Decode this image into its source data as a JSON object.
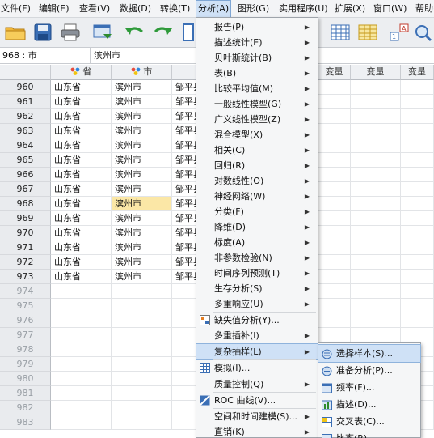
{
  "menubar": {
    "items": [
      {
        "label": "文件(F)"
      },
      {
        "label": "编辑(E)"
      },
      {
        "label": "查看(V)"
      },
      {
        "label": "数据(D)"
      },
      {
        "label": "转换(T)"
      },
      {
        "label": "分析(A)"
      },
      {
        "label": "图形(G)"
      },
      {
        "label": "实用程序(U)"
      },
      {
        "label": "扩展(X)"
      },
      {
        "label": "窗口(W)"
      },
      {
        "label": "帮助("
      }
    ],
    "active_index": 5
  },
  "cell_bar": {
    "ref": "968 : 市",
    "value": "滨州市"
  },
  "grid": {
    "columns": [
      "省",
      "市",
      "",
      "变量",
      "变量",
      "变量"
    ],
    "rows": [
      {
        "num": "960",
        "a": "山东省",
        "b": "滨州市",
        "c": "邹平县"
      },
      {
        "num": "961",
        "a": "山东省",
        "b": "滨州市",
        "c": "邹平县"
      },
      {
        "num": "962",
        "a": "山东省",
        "b": "滨州市",
        "c": "邹平县"
      },
      {
        "num": "963",
        "a": "山东省",
        "b": "滨州市",
        "c": "邹平县"
      },
      {
        "num": "964",
        "a": "山东省",
        "b": "滨州市",
        "c": "邹平县"
      },
      {
        "num": "965",
        "a": "山东省",
        "b": "滨州市",
        "c": "邹平县"
      },
      {
        "num": "966",
        "a": "山东省",
        "b": "滨州市",
        "c": "邹平县"
      },
      {
        "num": "967",
        "a": "山东省",
        "b": "滨州市",
        "c": "邹平县"
      },
      {
        "num": "968",
        "a": "山东省",
        "b": "滨州市",
        "c": "邹平县"
      },
      {
        "num": "969",
        "a": "山东省",
        "b": "滨州市",
        "c": "邹平县"
      },
      {
        "num": "970",
        "a": "山东省",
        "b": "滨州市",
        "c": "邹平县"
      },
      {
        "num": "971",
        "a": "山东省",
        "b": "滨州市",
        "c": "邹平县"
      },
      {
        "num": "972",
        "a": "山东省",
        "b": "滨州市",
        "c": "邹平县"
      },
      {
        "num": "973",
        "a": "山东省",
        "b": "滨州市",
        "c": "邹平县"
      },
      {
        "num": "974",
        "a": "",
        "b": "",
        "c": ""
      },
      {
        "num": "975",
        "a": "",
        "b": "",
        "c": ""
      },
      {
        "num": "976",
        "a": "",
        "b": "",
        "c": ""
      },
      {
        "num": "977",
        "a": "",
        "b": "",
        "c": ""
      },
      {
        "num": "978",
        "a": "",
        "b": "",
        "c": ""
      },
      {
        "num": "979",
        "a": "",
        "b": "",
        "c": ""
      },
      {
        "num": "980",
        "a": "",
        "b": "",
        "c": ""
      },
      {
        "num": "981",
        "a": "",
        "b": "",
        "c": ""
      },
      {
        "num": "982",
        "a": "",
        "b": "",
        "c": ""
      },
      {
        "num": "983",
        "a": "",
        "b": "",
        "c": ""
      }
    ],
    "selected_row": 8
  },
  "analysis_menu": {
    "items": [
      {
        "label": "报告(P)",
        "submenu": true
      },
      {
        "label": "描述统计(E)",
        "submenu": true
      },
      {
        "label": "贝叶斯统计(B)",
        "submenu": true
      },
      {
        "label": "表(B)",
        "submenu": true
      },
      {
        "label": "比较平均值(M)",
        "submenu": true
      },
      {
        "label": "一般线性模型(G)",
        "submenu": true
      },
      {
        "label": "广义线性模型(Z)",
        "submenu": true
      },
      {
        "label": "混合模型(X)",
        "submenu": true
      },
      {
        "label": "相关(C)",
        "submenu": true
      },
      {
        "label": "回归(R)",
        "submenu": true
      },
      {
        "label": "对数线性(O)",
        "submenu": true
      },
      {
        "label": "神经网络(W)",
        "submenu": true
      },
      {
        "label": "分类(F)",
        "submenu": true
      },
      {
        "label": "降维(D)",
        "submenu": true
      },
      {
        "label": "标度(A)",
        "submenu": true
      },
      {
        "label": "非参数检验(N)",
        "submenu": true
      },
      {
        "label": "时间序列预测(T)",
        "submenu": true
      },
      {
        "label": "生存分析(S)",
        "submenu": true
      },
      {
        "label": "多重响应(U)",
        "submenu": true
      },
      {
        "label": "缺失值分析(Y)...",
        "submenu": false,
        "icon": "missing-value-icon"
      },
      {
        "label": "多重插补(I)",
        "submenu": true
      },
      {
        "label": "复杂抽样(L)",
        "submenu": true
      },
      {
        "label": "模拟(I)...",
        "submenu": false,
        "icon": "simulation-icon"
      },
      {
        "label": "质量控制(Q)",
        "submenu": true
      },
      {
        "label": "ROC 曲线(V)...",
        "submenu": false,
        "icon": "roc-curve-icon"
      },
      {
        "label": "空间和时间建模(S)...",
        "submenu": true
      },
      {
        "label": "直销(K)",
        "submenu": true
      }
    ],
    "highlighted_index": 21
  },
  "submenu": {
    "items": [
      {
        "label": "选择样本(S)...",
        "icon": "select-sample-icon"
      },
      {
        "label": "准备分析(P)...",
        "icon": "prepare-analysis-icon"
      },
      {
        "label": "频率(F)...",
        "icon": "frequency-icon"
      },
      {
        "label": "描述(D)...",
        "icon": "descriptives-icon"
      },
      {
        "label": "交叉表(C)...",
        "icon": "crosstabs-icon"
      },
      {
        "label": "比率(R)...",
        "icon": "ratio-icon"
      }
    ],
    "highlighted_index": 0
  },
  "colors": {
    "accent": "#cfe1f6",
    "selected_cell": "#fbe7a6"
  }
}
